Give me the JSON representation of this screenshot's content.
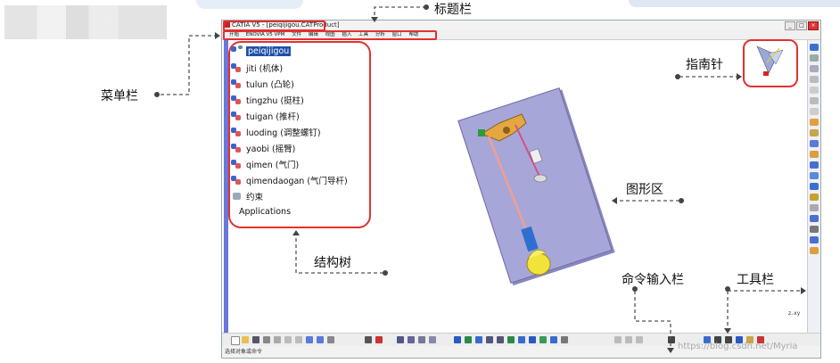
{
  "window": {
    "title": "CATIA V5 - [peiqijigou.CATProduct]"
  },
  "menubar": {
    "items": [
      "开始",
      "ENOVIA V5 VPM",
      "文件",
      "编辑",
      "视图",
      "插入",
      "工具",
      "分析",
      "窗口",
      "帮助"
    ]
  },
  "tree": {
    "root": "peiqijigou",
    "nodes": [
      "jiti (机体)",
      "tulun (凸轮)",
      "tingzhu (挺柱)",
      "tuigan (推杆)",
      "luoding (调整螺钉)",
      "yaobi (摇臂)",
      "qimen (气门)",
      "qimendaogan (气门导杆)",
      "约束",
      "Applications"
    ]
  },
  "status": {
    "prompt": "选择对象或命令"
  },
  "annotations": {
    "title_bar": "标题栏",
    "menu_bar": "菜单栏",
    "compass": "指南针",
    "graphics_area": "图形区",
    "spec_tree": "结构树",
    "command_input": "命令输入栏",
    "toolbar": "工具栏"
  },
  "watermark": "https://blog.csdn.net/Myria",
  "colors": {
    "annotation_red": "#e23030",
    "tree_axis": "#6a78d9",
    "plate": "#a7a6d8",
    "selection": "#1f4fa8"
  }
}
